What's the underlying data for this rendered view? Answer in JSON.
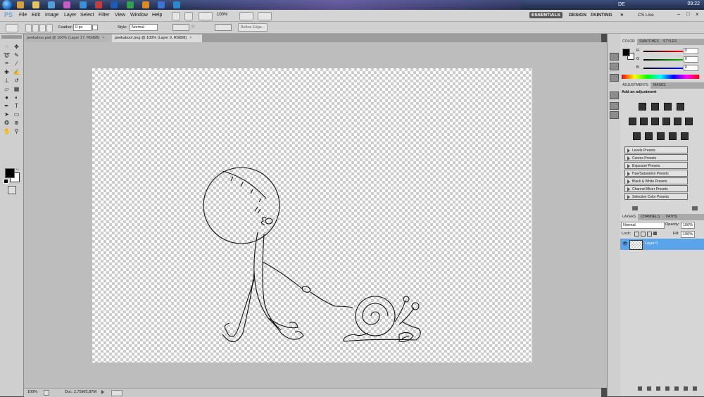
{
  "taskbar": {
    "language": "DE",
    "clock": "09:22"
  },
  "menubar": {
    "logo": "PS",
    "menus": [
      "File",
      "Edit",
      "Image",
      "Layer",
      "Select",
      "Filter",
      "View",
      "Window",
      "Help"
    ],
    "zoom_value": "100%",
    "workspaces": [
      "ESSENTIALS",
      "DESIGN",
      "PAINTING"
    ],
    "more": "»",
    "cs_live": "CS Live",
    "window_buttons": [
      "–",
      "□",
      "×"
    ]
  },
  "options": {
    "feather_label": "Feather:",
    "feather_value": "0 px",
    "style_label": "Style:",
    "style_value": "Normal",
    "refine_label": "Refine Edge..."
  },
  "tabs": [
    {
      "title": "peekaboo.psd @ 100% (Layer 17, RGB/8)",
      "active": false
    },
    {
      "title": "peekaboo!.png @ 100% (Layer 0, RGB/8)",
      "active": true
    }
  ],
  "status": {
    "zoom": "100%",
    "doc": "Doc: 2,75M/2,87M"
  },
  "color_panel": {
    "tabs": [
      "COLOR",
      "SWATCHES",
      "STYLES"
    ],
    "channels": [
      {
        "label": "R",
        "value": "0",
        "color": "#ff0000"
      },
      {
        "label": "G",
        "value": "0",
        "color": "#00a000"
      },
      {
        "label": "B",
        "value": "0",
        "color": "#0000ff"
      }
    ]
  },
  "adjustments_panel": {
    "tabs": [
      "ADJUSTMENTS",
      "MASKS"
    ],
    "title": "Add an adjustment",
    "presets": [
      "Levels Presets",
      "Curves Presets",
      "Exposure Presets",
      "Hue/Saturation Presets",
      "Black & White Presets",
      "Channel Mixer Presets",
      "Selective Color Presets"
    ]
  },
  "layers_panel": {
    "tabs": [
      "LAYERS",
      "CHANNELS",
      "PATHS"
    ],
    "blend_mode": "Normal",
    "opacity_label": "Opacity:",
    "opacity_value": "100%",
    "lock_label": "Lock:",
    "fill_label": "Fill:",
    "fill_value": "100%",
    "layer_name": "Layer 0"
  },
  "colors": {
    "accent": "#5aa4ec",
    "foreground": "#000000",
    "background": "#ffffff"
  }
}
